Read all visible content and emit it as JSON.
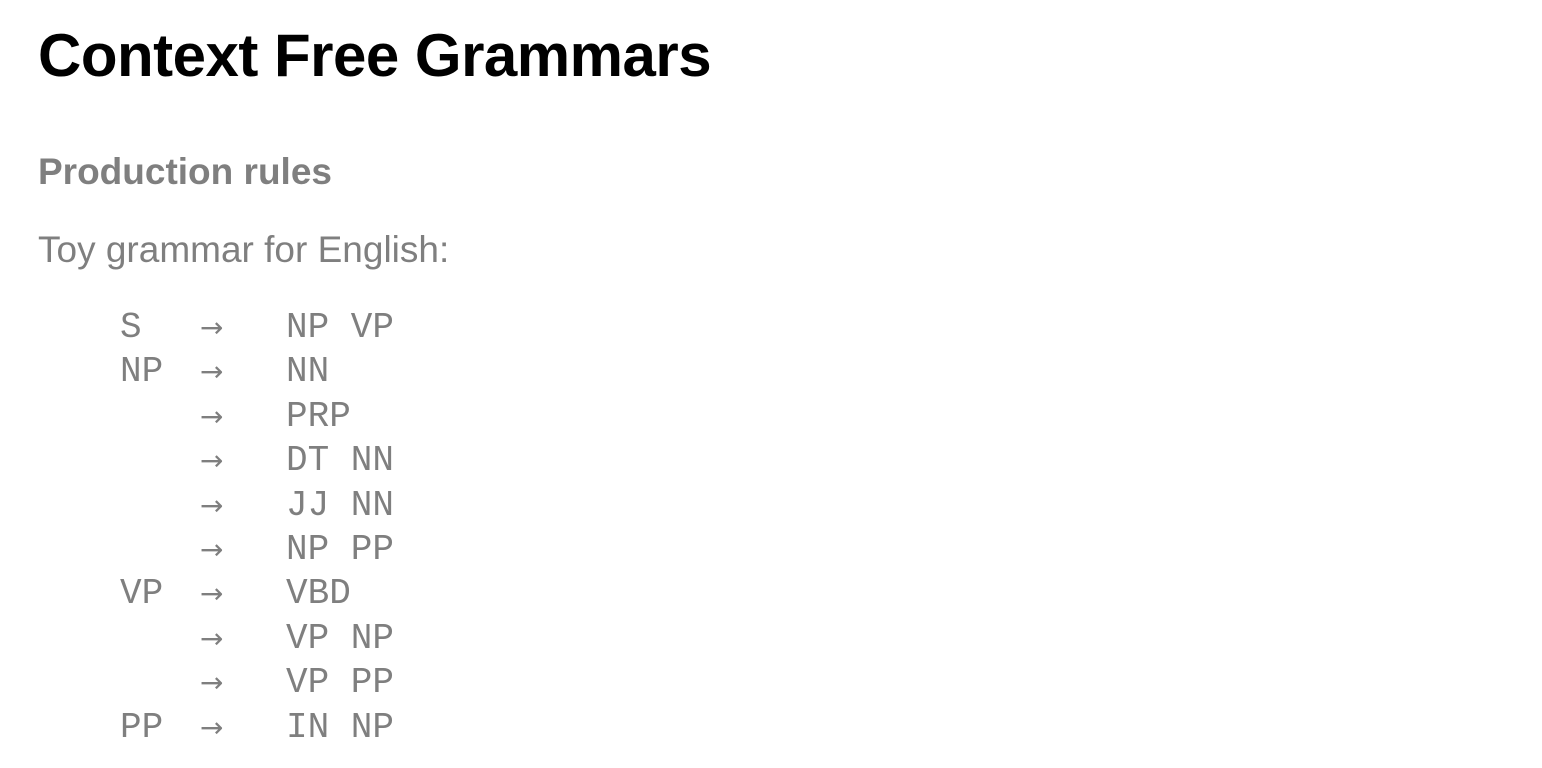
{
  "title": "Context Free Grammars",
  "subtitle": "Production rules",
  "intro": "Toy grammar for English:",
  "rules": [
    {
      "lhs": "S",
      "arrow": "→",
      "rhs": "NP VP"
    },
    {
      "lhs": "NP",
      "arrow": "→",
      "rhs": "NN"
    },
    {
      "lhs": "",
      "arrow": "→",
      "rhs": "PRP"
    },
    {
      "lhs": "",
      "arrow": "→",
      "rhs": "DT NN"
    },
    {
      "lhs": "",
      "arrow": "→",
      "rhs": "JJ NN"
    },
    {
      "lhs": "",
      "arrow": "→",
      "rhs": "NP PP"
    },
    {
      "lhs": "VP",
      "arrow": "→",
      "rhs": "VBD"
    },
    {
      "lhs": "",
      "arrow": "→",
      "rhs": "VP NP"
    },
    {
      "lhs": "",
      "arrow": "→",
      "rhs": "VP PP"
    },
    {
      "lhs": "PP",
      "arrow": "→",
      "rhs": "IN NP"
    }
  ]
}
